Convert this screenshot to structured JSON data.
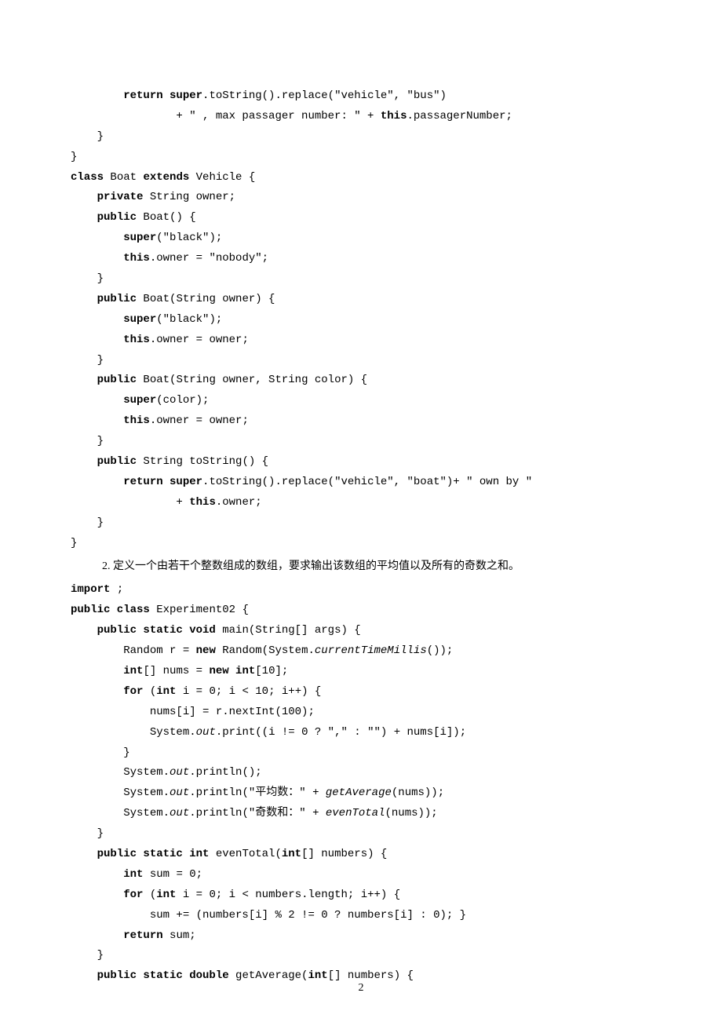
{
  "block1": [
    [
      [
        "p",
        "        "
      ],
      [
        "b",
        "return super"
      ],
      [
        "p",
        ".toString().replace(\"vehicle\", \"bus\")"
      ]
    ],
    [
      [
        "p",
        "                + \" , max passager number: \" + "
      ],
      [
        "b",
        "this"
      ],
      [
        "p",
        ".passagerNumber;"
      ]
    ],
    [
      [
        "p",
        "    }"
      ]
    ],
    [
      [
        "p",
        "}"
      ]
    ],
    [
      [
        "b",
        "class"
      ],
      [
        "p",
        " Boat "
      ],
      [
        "b",
        "extends"
      ],
      [
        "p",
        " Vehicle {"
      ]
    ],
    [
      [
        "p",
        "    "
      ],
      [
        "b",
        "private"
      ],
      [
        "p",
        " String owner;"
      ]
    ],
    [
      [
        "p",
        "    "
      ],
      [
        "b",
        "public"
      ],
      [
        "p",
        " Boat() {"
      ]
    ],
    [
      [
        "p",
        "        "
      ],
      [
        "b",
        "super"
      ],
      [
        "p",
        "(\"black\");"
      ]
    ],
    [
      [
        "p",
        "        "
      ],
      [
        "b",
        "this"
      ],
      [
        "p",
        ".owner = \"nobody\";"
      ]
    ],
    [
      [
        "p",
        "    }"
      ]
    ],
    [
      [
        "p",
        "    "
      ],
      [
        "b",
        "public"
      ],
      [
        "p",
        " Boat(String owner) {"
      ]
    ],
    [
      [
        "p",
        "        "
      ],
      [
        "b",
        "super"
      ],
      [
        "p",
        "(\"black\");"
      ]
    ],
    [
      [
        "p",
        "        "
      ],
      [
        "b",
        "this"
      ],
      [
        "p",
        ".owner = owner;"
      ]
    ],
    [
      [
        "p",
        "    }"
      ]
    ],
    [
      [
        "p",
        "    "
      ],
      [
        "b",
        "public"
      ],
      [
        "p",
        " Boat(String owner, String color) {"
      ]
    ],
    [
      [
        "p",
        "        "
      ],
      [
        "b",
        "super"
      ],
      [
        "p",
        "(color);"
      ]
    ],
    [
      [
        "p",
        "        "
      ],
      [
        "b",
        "this"
      ],
      [
        "p",
        ".owner = owner;"
      ]
    ],
    [
      [
        "p",
        "    }"
      ]
    ],
    [
      [
        "p",
        "    "
      ],
      [
        "b",
        "public"
      ],
      [
        "p",
        " String toString() {"
      ]
    ],
    [
      [
        "p",
        "        "
      ],
      [
        "b",
        "return super"
      ],
      [
        "p",
        ".toString().replace(\"vehicle\", \"boat\")+ \" own by \""
      ]
    ],
    [
      [
        "p",
        "                + "
      ],
      [
        "b",
        "this"
      ],
      [
        "p",
        ".owner;"
      ]
    ],
    [
      [
        "p",
        "    }"
      ]
    ],
    [
      [
        "p",
        "}"
      ]
    ]
  ],
  "paragraph": "2. 定义一个由若干个整数组成的数组，要求输出该数组的平均值以及所有的奇数之和。",
  "block2": [
    [
      [
        "b",
        "import"
      ],
      [
        "p",
        " ;"
      ]
    ],
    [
      [
        "b",
        "public class"
      ],
      [
        "p",
        " Experiment02 {"
      ]
    ],
    [
      [
        "p",
        "    "
      ],
      [
        "b",
        "public static void"
      ],
      [
        "p",
        " main(String[] args) {"
      ]
    ],
    [
      [
        "p",
        "        Random r = "
      ],
      [
        "b",
        "new"
      ],
      [
        "p",
        " Random(System."
      ],
      [
        "i",
        "currentTimeMillis"
      ],
      [
        "p",
        "());"
      ]
    ],
    [
      [
        "p",
        "        "
      ],
      [
        "b",
        "int"
      ],
      [
        "p",
        "[] nums = "
      ],
      [
        "b",
        "new int"
      ],
      [
        "p",
        "[10];"
      ]
    ],
    [
      [
        "p",
        "        "
      ],
      [
        "b",
        "for"
      ],
      [
        "p",
        " ("
      ],
      [
        "b",
        "int"
      ],
      [
        "p",
        " i = 0; i < 10; i++) {"
      ]
    ],
    [
      [
        "p",
        "            nums[i] = r.nextInt(100);"
      ]
    ],
    [
      [
        "p",
        "            System."
      ],
      [
        "i",
        "out"
      ],
      [
        "p",
        ".print((i != 0 ? \",\" : \"\") + nums[i]);"
      ]
    ],
    [
      [
        "p",
        "        }"
      ]
    ],
    [
      [
        "p",
        "        System."
      ],
      [
        "i",
        "out"
      ],
      [
        "p",
        ".println();"
      ]
    ],
    [
      [
        "p",
        "        System."
      ],
      [
        "i",
        "out"
      ],
      [
        "p",
        ".println(\"平均数：\" + "
      ],
      [
        "i",
        "getAverage"
      ],
      [
        "p",
        "(nums));"
      ]
    ],
    [
      [
        "p",
        "        System."
      ],
      [
        "i",
        "out"
      ],
      [
        "p",
        ".println(\"奇数和：\" + "
      ],
      [
        "i",
        "evenTotal"
      ],
      [
        "p",
        "(nums));"
      ]
    ],
    [
      [
        "p",
        "    }"
      ]
    ],
    [
      [
        "p",
        "    "
      ],
      [
        "b",
        "public static int"
      ],
      [
        "p",
        " evenTotal("
      ],
      [
        "b",
        "int"
      ],
      [
        "p",
        "[] numbers) {"
      ]
    ],
    [
      [
        "p",
        "        "
      ],
      [
        "b",
        "int"
      ],
      [
        "p",
        " sum = 0;"
      ]
    ],
    [
      [
        "p",
        "        "
      ],
      [
        "b",
        "for"
      ],
      [
        "p",
        " ("
      ],
      [
        "b",
        "int"
      ],
      [
        "p",
        " i = 0; i < numbers.length; i++) {"
      ]
    ],
    [
      [
        "p",
        "            sum += (numbers[i] % 2 != 0 ? numbers[i] : 0); }"
      ]
    ],
    [
      [
        "p",
        "        "
      ],
      [
        "b",
        "return"
      ],
      [
        "p",
        " sum;"
      ]
    ],
    [
      [
        "p",
        "    }"
      ]
    ],
    [
      [
        "p",
        "    "
      ],
      [
        "b",
        "public static double"
      ],
      [
        "p",
        " getAverage("
      ],
      [
        "b",
        "int"
      ],
      [
        "p",
        "[] numbers) {"
      ]
    ]
  ],
  "pageNumber": "2"
}
